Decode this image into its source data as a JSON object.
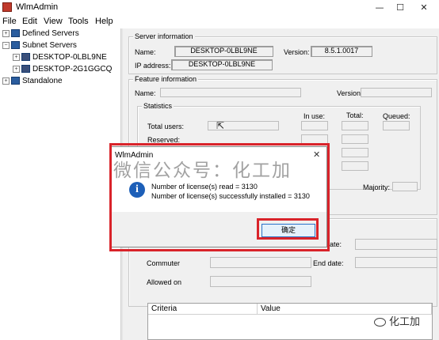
{
  "window": {
    "title": "WlmAdmin",
    "controls": [
      "—",
      "☐",
      "✕"
    ]
  },
  "menu": [
    "File",
    "Edit",
    "View",
    "Tools",
    "Help"
  ],
  "tree": {
    "items": [
      {
        "label": "Defined Servers",
        "expander": "+"
      },
      {
        "label": "Subnet Servers",
        "expander": "−"
      },
      {
        "label": "DESKTOP-0LBL9NE",
        "expander": "+"
      },
      {
        "label": "DESKTOP-2G1GGCQ",
        "expander": "+"
      },
      {
        "label": "Standalone",
        "expander": "+"
      }
    ]
  },
  "server_info": {
    "legend": "Server information",
    "name_label": "Name:",
    "name_value": "DESKTOP-0LBL9NE",
    "version_label": "Version:",
    "version_value": "8.5.1.0017",
    "ip_label": "IP address:",
    "ip_value": "DESKTOP-0LBL9NE"
  },
  "feature_info": {
    "legend": "Feature information",
    "name_label": "Name:",
    "version_label": "Version:",
    "statistics_legend": "Statistics",
    "in_use": "In use:",
    "total": "Total:",
    "queued": "Queued:",
    "total_users": "Total users:",
    "reserved": "Reserved:",
    "majority": "Majority:",
    "end_date_partial": "t date:",
    "commuter": "Commuter",
    "end_date": "End date:",
    "allowed_on": "Allowed on"
  },
  "grid": {
    "columns": [
      "Criteria",
      "Value"
    ]
  },
  "dialog": {
    "title": "WlmAdmin",
    "close": "✕",
    "icon": "i",
    "line1": "Number of license(s) read = 3130",
    "line2": "Number of license(s) successfully installed = 3130",
    "ok_label": "确定"
  },
  "watermark": "微信公众号：化工加",
  "brand": "化工加",
  "colors": {
    "highlight": "#d9232a",
    "info": "#1d5fb8"
  }
}
